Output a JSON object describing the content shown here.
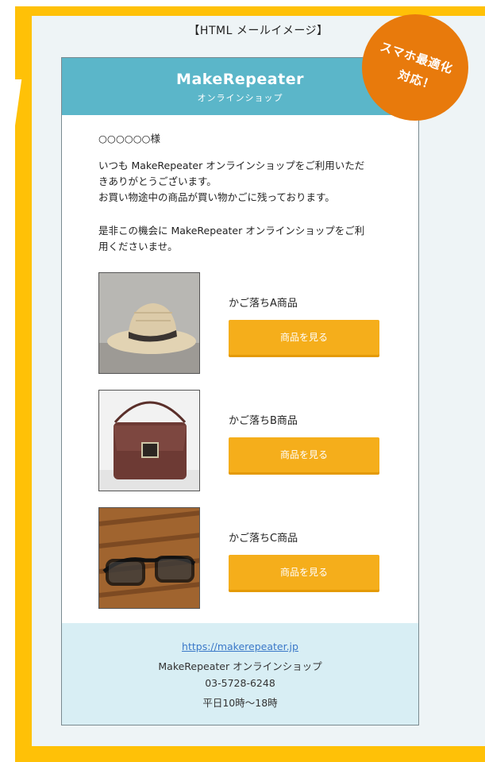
{
  "caption": "【HTML メールイメージ】",
  "badge": {
    "line1": "スマホ最適化",
    "line2": "対応！"
  },
  "header": {
    "brand": "MakeRepeater",
    "subtitle": "オンラインショップ"
  },
  "greeting": "○○○○○○様",
  "message": {
    "line1": "いつも MakeRepeater オンラインショップをご利用いただ",
    "line2": "きありがとうございます。",
    "line3": "お買い物途中の商品が買い物かごに残っております。",
    "line4": "是非この機会に MakeRepeater オンラインショップをご利",
    "line5": "用くださいませ。"
  },
  "products": [
    {
      "name": "かご落ちA商品",
      "button": "商品を見る",
      "image": "hat-photo"
    },
    {
      "name": "かご落ちB商品",
      "button": "商品を見る",
      "image": "bag-photo"
    },
    {
      "name": "かご落ちC商品",
      "button": "商品を見る",
      "image": "glasses-photo"
    }
  ],
  "footer": {
    "url": "https://makerepeater.jp",
    "shop": "MakeRepeater オンラインショップ",
    "phone": "03-5728-6248",
    "hours": "平日10時～18時"
  },
  "colors": {
    "frame": "#ffc107",
    "header": "#5bb6c9",
    "button": "#f5ae1b",
    "badge": "#e87a0c",
    "footer": "#d8eef4"
  }
}
